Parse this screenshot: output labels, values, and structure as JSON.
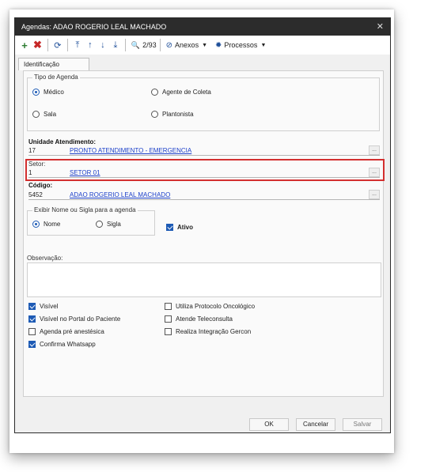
{
  "window": {
    "title": "Agendas: ADAO ROGERIO LEAL MACHADO",
    "close": "✕"
  },
  "toolbar": {
    "add": "+",
    "delete": "✖",
    "refresh": "⟳",
    "first": "⤒",
    "up": "↑",
    "down": "↓",
    "last": "⤓",
    "search": "🔍",
    "record_position": "2/93",
    "attachments_label": "Anexos",
    "processes_label": "Processos",
    "caret": "▼"
  },
  "tabs": [
    {
      "label": "Identificação"
    }
  ],
  "tipo_agenda": {
    "label": "Tipo de Agenda",
    "options": [
      {
        "label": "Médico",
        "selected": true
      },
      {
        "label": "Agente de Coleta",
        "selected": false
      },
      {
        "label": "Sala",
        "selected": false
      },
      {
        "label": "Plantonista",
        "selected": false
      }
    ]
  },
  "unidade": {
    "label": "Unidade Atendimento:",
    "code": "17",
    "name": "PRONTO ATENDIMENTO - EMERGENCIA"
  },
  "setor": {
    "label": "Setor:",
    "code": "1",
    "name": "SETOR 01"
  },
  "codigo": {
    "label": "Código:",
    "code": "5452",
    "name": "ADAO ROGERIO LEAL MACHADO"
  },
  "lookup_button": "...",
  "exibir": {
    "label": "Exibir Nome ou Sigla para a agenda",
    "options": [
      {
        "label": "Nome",
        "selected": true
      },
      {
        "label": "Sigla",
        "selected": false
      }
    ]
  },
  "ativo": {
    "label": "Ativo",
    "checked": true
  },
  "observacao": {
    "label": "Observação:"
  },
  "checkboxes_left": [
    {
      "label": "Visível",
      "checked": true
    },
    {
      "label": "Visível no Portal do Paciente",
      "checked": true
    },
    {
      "label": "Agenda pré anestésica",
      "checked": false
    },
    {
      "label": "Confirma Whatsapp",
      "checked": true
    }
  ],
  "checkboxes_right": [
    {
      "label": "Utiliza Protocolo Oncológico",
      "checked": false
    },
    {
      "label": "Atende Teleconsulta",
      "checked": false
    },
    {
      "label": "Realiza Integração Gercon",
      "checked": false
    }
  ],
  "footer": {
    "ok": "OK",
    "cancel": "Cancelar",
    "save": "Salvar"
  },
  "colors": {
    "accent": "#1e5bb5",
    "link": "#1a3ec9",
    "highlight": "#d32f2f",
    "titlebar": "#2c2c2c"
  }
}
